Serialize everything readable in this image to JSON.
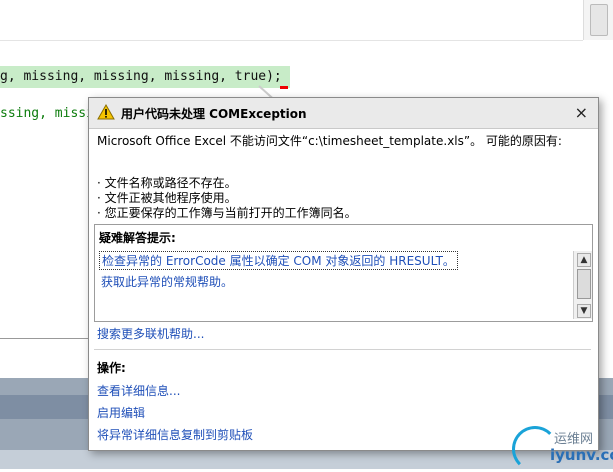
{
  "editor": {
    "code_line1": "g, missing, missing, missing, true);",
    "code_line2": "ssing, missi"
  },
  "popup": {
    "title": "用户代码未处理 COMException",
    "close_glyph": "×",
    "message": "Microsoft Office Excel 不能访问文件“c:\\timesheet_template.xls”。 可能的原因有:",
    "reasons": [
      "文件名称或路径不存在。",
      "文件正被其他程序使用。",
      "您正要保存的工作簿与当前打开的工作簿同名。"
    ],
    "tips_title": "疑难解答提示:",
    "tips": [
      "检查异常的 ErrorCode 属性以确定 COM 对象返回的 HRESULT。",
      "获取此异常的常规帮助。"
    ],
    "more_help": "搜索更多联机帮助...",
    "actions_title": "操作:",
    "actions": [
      "查看详细信息...",
      "启用编辑",
      "将异常详细信息复制到剪贴板"
    ]
  },
  "watermark": {
    "line1": "运维网",
    "line2": "iyunv.com"
  },
  "colors": {
    "link": "#1f4fb8",
    "code_highlight": "#c8ecc8",
    "code_green": "#0c7c0c",
    "warning_yellow": "#f5c400"
  }
}
